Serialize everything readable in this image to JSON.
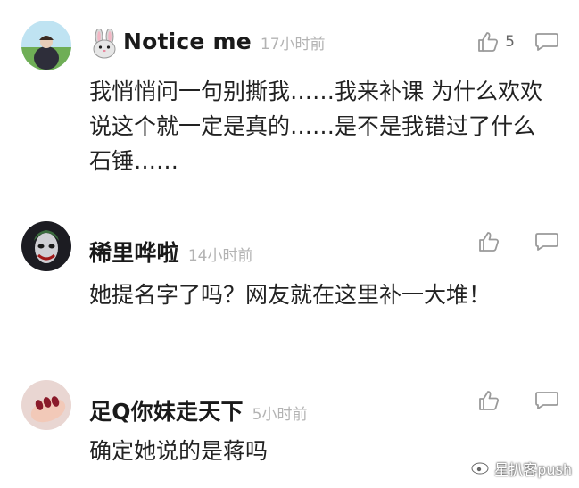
{
  "comments": [
    {
      "username": "Notice me",
      "timestamp": "17小时前",
      "like_count": "5",
      "text": "我悄悄问一句别撕我……我来补课 为什么欢欢说这个就一定是真的……是不是我错过了什么石锤……"
    },
    {
      "username": "稀里哗啦",
      "timestamp": "14小时前",
      "like_count": "",
      "text": "她提名字了吗？网友就在这里补一大堆！"
    },
    {
      "username": "足Q你妹走天下",
      "timestamp": "5小时前",
      "like_count": "",
      "text": "确定她说的是蒋吗"
    }
  ],
  "watermark": {
    "text": "星扒客push"
  },
  "icons": {
    "like": "thumbs-up-icon",
    "reply": "speech-bubble-icon",
    "username_emoji": "rabbit-face-icon"
  },
  "colors": {
    "timestamp": "#b3b3b3",
    "text": "#222222",
    "icon_stroke": "#9a9a9a"
  }
}
